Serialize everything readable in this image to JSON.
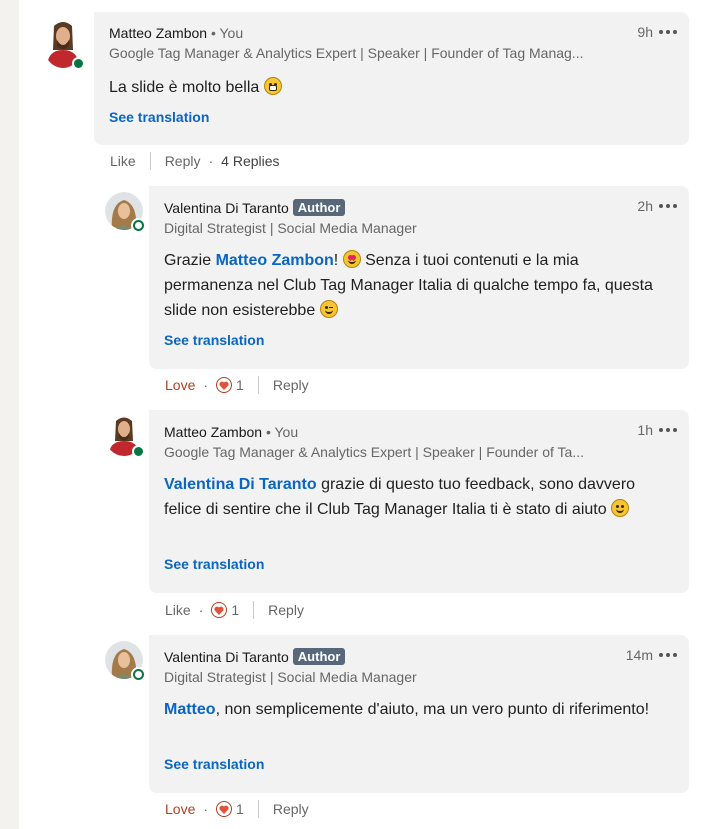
{
  "comments": [
    {
      "author": "Matteo Zambon",
      "you": "• You",
      "headline": "Google Tag Manager & Analytics Expert | Speaker | Founder of Tag Manag...",
      "time": "9h",
      "text": "La slide è molto bella",
      "translate": "See translation",
      "like": "Like",
      "reply": "Reply",
      "replies": "4 Replies"
    },
    {
      "author": "Valentina Di Taranto",
      "badge": "Author",
      "headline": "Digital Strategist | Social Media Manager",
      "time": "2h",
      "text_a": "Grazie ",
      "mention": "Matteo Zambon",
      "text_b": "! ",
      "text_c": " Senza i tuoi contenuti e la mia permanenza nel Club Tag Manager Italia di qualche tempo fa, questa slide non esisterebbe ",
      "translate": "See translation",
      "reaction": "Love",
      "count": "1",
      "reply": "Reply"
    },
    {
      "author": "Matteo Zambon",
      "you": "• You",
      "headline": "Google Tag Manager & Analytics Expert | Speaker | Founder of Ta...",
      "time": "1h",
      "mention": "Valentina Di Taranto",
      "text_a": " grazie di questo tuo feedback, sono davvero felice di sentire che il Club Tag Manager Italia ti è stato di aiuto ",
      "translate": "See translation",
      "reaction": "Like",
      "count": "1",
      "reply": "Reply"
    },
    {
      "author": "Valentina Di Taranto",
      "badge": "Author",
      "headline": "Digital Strategist | Social Media Manager",
      "time": "14m",
      "mention": "Matteo",
      "text_a": ", non semplicemente d'aiuto, ma un vero punto di riferimento!",
      "translate": "See translation",
      "reaction": "Love",
      "count": "1",
      "reply": "Reply"
    }
  ],
  "colors": {
    "link": "#0a66c2",
    "love": "#b24020",
    "online": "#057642",
    "author_badge": "#56687a"
  }
}
